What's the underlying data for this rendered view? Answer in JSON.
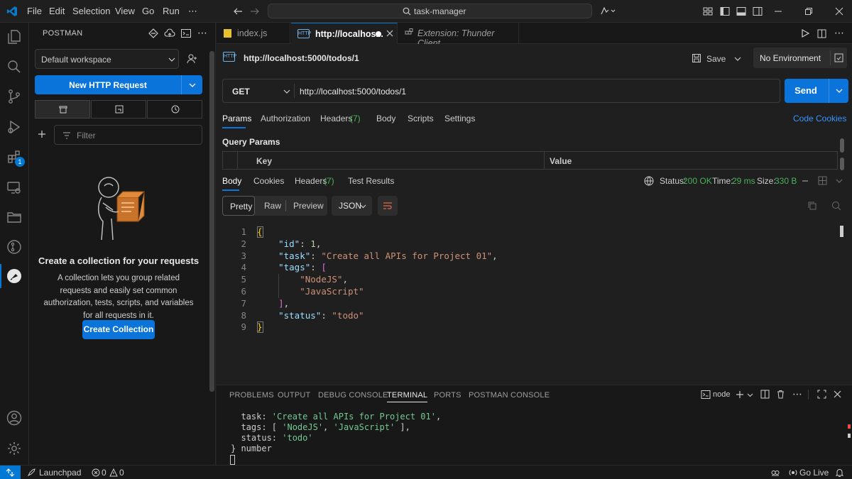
{
  "menu": [
    "File",
    "Edit",
    "Selection",
    "View",
    "Go",
    "Run",
    "⋯"
  ],
  "command_center": "task-manager",
  "activity_badge": "1",
  "sidebar": {
    "title": "POSTMAN",
    "workspace": "Default workspace",
    "new_request": "New HTTP Request",
    "filter_placeholder": "Filter",
    "empty_title": "Create a collection for your requests",
    "empty_desc": "A collection lets you group related requests and easily set common authorization, tests, scripts, and variables for all requests in it.",
    "create_collection": "Create Collection"
  },
  "tabs": [
    {
      "label": "index.js"
    },
    {
      "label": "http://localhos..."
    },
    {
      "label": "Extension: Thunder Client"
    }
  ],
  "request": {
    "title": "http://localhost:5000/todos/1",
    "save": "Save",
    "environment": "No Environment",
    "method": "GET",
    "url": "http://localhost:5000/todos/1",
    "send": "Send",
    "tabs": [
      "Params",
      "Authorization",
      "Headers",
      "Body",
      "Scripts",
      "Settings"
    ],
    "headers_count": "(7)",
    "code_link": "Code",
    "cookies_link": "Cookies",
    "query_params_title": "Query Params",
    "col_key": "Key",
    "col_value": "Value"
  },
  "response": {
    "tabs": [
      "Body",
      "Cookies",
      "Headers",
      "Test Results"
    ],
    "headers_count": "(7)",
    "status_label": "Status:",
    "status_value": "200 OK",
    "time_label": "Time:",
    "time_value": "29 ms",
    "size_label": "Size:",
    "size_value": "330 B",
    "views": [
      "Pretty",
      "Raw",
      "Preview"
    ],
    "format": "JSON",
    "lines": [
      "1",
      "2",
      "3",
      "4",
      "5",
      "6",
      "7",
      "8",
      "9"
    ],
    "json": {
      "id_key": "\"id\"",
      "id_val": "1",
      "task_key": "\"task\"",
      "task_val": "\"Create all APIs for Project 01\"",
      "tags_key": "\"tags\"",
      "tag1": "\"NodeJS\"",
      "tag2": "\"JavaScript\"",
      "status_key": "\"status\"",
      "status_val": "\"todo\""
    }
  },
  "panel": {
    "tabs": [
      "PROBLEMS",
      "OUTPUT",
      "DEBUG CONSOLE",
      "TERMINAL",
      "PORTS",
      "POSTMAN CONSOLE"
    ],
    "shell": "node",
    "terminal": {
      "l1_key": "  task: ",
      "l1_val": "'Create all APIs for Project 01'",
      "l2_key": "  tags: [ ",
      "l2_v1": "'NodeJS'",
      "l2_sep": ", ",
      "l2_v2": "'JavaScript'",
      "l2_end": " ],",
      "l3_key": "  status: ",
      "l3_val": "'todo'",
      "l4": "} number"
    }
  },
  "statusbar": {
    "launchpad": "Launchpad",
    "errors": "0",
    "warnings": "0",
    "golive": "Go Live"
  }
}
